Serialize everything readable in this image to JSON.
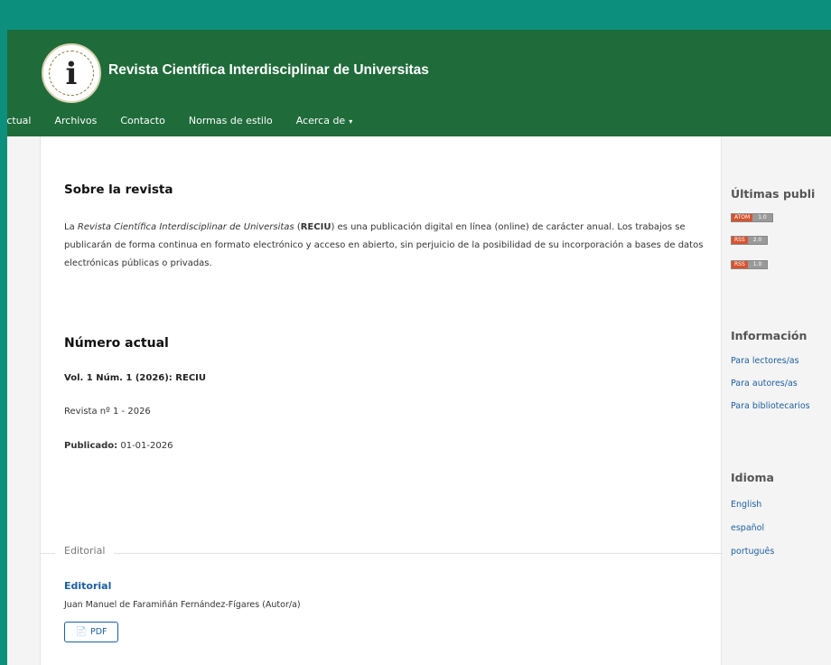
{
  "header": {
    "logo_glyph": "i",
    "site_title": "Revista Científica Interdisciplinar de Universitas"
  },
  "nav": {
    "items": [
      "Actual",
      "Archivos",
      "Contacto",
      "Normas de estilo",
      "Acerca de"
    ],
    "dropdown_caret": "▾"
  },
  "about": {
    "heading": "Sobre la revista",
    "text_prefix": "La ",
    "journal_name_italic": "Revista Científica Interdisciplinar de Universitas",
    "text_mid": " (",
    "abbrev": "RECIU",
    "text_suffix": ") es una publicación digital en línea (online) de carácter anual. Los trabajos se publicarán de forma continua en formato electrónico y acceso en abierto, sin perjuicio de la posibilidad de su incorporación a bases de datos electrónicas públicas o privadas."
  },
  "current_issue": {
    "heading": "Número actual",
    "volume": "Vol. 1 Núm. 1 (2026): RECIU",
    "issue_label": "Revista nº 1 - 2026",
    "published_label": "Publicado:",
    "published_date": " 01-01-2026"
  },
  "section": {
    "label": "Editorial",
    "article_title": "Editorial",
    "article_author": "Juan Manuel de Faramiñán Fernández-Fígares (Autor/a)",
    "pdf_label": "PDF",
    "pdf_icon": "📄"
  },
  "sidebar": {
    "latest_heading": "Últimas publi",
    "feeds": [
      {
        "left": "ATOM",
        "right": "1.0"
      },
      {
        "left": "RSS",
        "right": "2.0"
      },
      {
        "left": "RSS",
        "right": "1.0"
      }
    ],
    "info_heading": "Información",
    "info_links": [
      "Para lectores/as",
      "Para autores/as",
      "Para bibliotecarios"
    ],
    "lang_heading": "Idioma",
    "languages": [
      "English",
      "español",
      "português"
    ]
  },
  "colors": {
    "outer_bg": "#0d8f7e",
    "header_bg": "#1f6b3a",
    "link": "#1d5fa0"
  }
}
